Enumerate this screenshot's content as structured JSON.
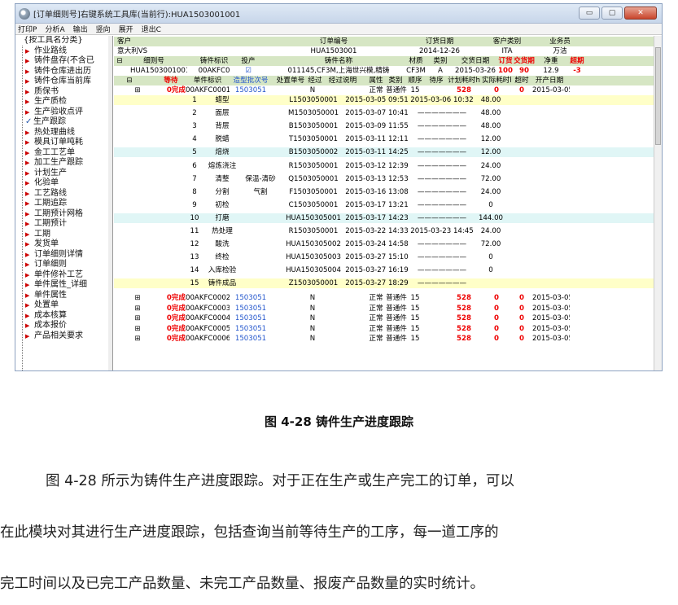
{
  "window": {
    "title": "[订单细则号]右键系统工具库(当前行):HUA1503001001",
    "buttons": {
      "minimize": "▭",
      "maximize": "▢",
      "close": "✕"
    }
  },
  "menu": [
    "打印P",
    "分析A",
    "输出",
    "竖向",
    "展开",
    "退出C"
  ],
  "tree": {
    "root": "{按工具名分类}",
    "items": [
      {
        "label": "作业路线",
        "mark": "▶"
      },
      {
        "label": "铸件盘存(不含已",
        "mark": "▶"
      },
      {
        "label": "铸件仓库进出历",
        "mark": "▶"
      },
      {
        "label": "铸件仓库当前库",
        "mark": "▶"
      },
      {
        "label": "质保书",
        "mark": "▶"
      },
      {
        "label": "生产质检",
        "mark": "▶"
      },
      {
        "label": "生产验收点评",
        "mark": "▶"
      },
      {
        "label": "生产跟踪",
        "mark": "✓"
      },
      {
        "label": "热处理曲线",
        "mark": "▶"
      },
      {
        "label": "模具订单吨耗",
        "mark": "▶"
      },
      {
        "label": "金工工艺单",
        "mark": "▶"
      },
      {
        "label": "加工生产跟踪",
        "mark": "▶"
      },
      {
        "label": "计划生产",
        "mark": "▶"
      },
      {
        "label": "化验单",
        "mark": "▶"
      },
      {
        "label": "工艺路线",
        "mark": "▶"
      },
      {
        "label": "工期追踪",
        "mark": "▶"
      },
      {
        "label": "工期预计网格",
        "mark": "▶"
      },
      {
        "label": "工期预计",
        "mark": "▶"
      },
      {
        "label": "工期",
        "mark": "▶"
      },
      {
        "label": "发货单",
        "mark": "▶"
      },
      {
        "label": "订单细则详情",
        "mark": "▶"
      },
      {
        "label": "订单细则",
        "mark": "▶"
      },
      {
        "label": "单件修补工艺",
        "mark": "▶"
      },
      {
        "label": "单件属性_详细",
        "mark": "▶"
      },
      {
        "label": "单件属性",
        "mark": "▶"
      },
      {
        "label": "处置单",
        "mark": "▶"
      },
      {
        "label": "成本核算",
        "mark": "▶"
      },
      {
        "label": "成本报价",
        "mark": "▶"
      },
      {
        "label": "产品相关要求",
        "mark": "▶"
      }
    ]
  },
  "order_header": {
    "cols": [
      "客户",
      "订单编号",
      "订货日期",
      "客户类别",
      "业务员"
    ],
    "vals": [
      "意大利VS",
      "HUA1503001",
      "2014-12-26",
      "ITA",
      "万洁"
    ]
  },
  "detail_header": {
    "cols": [
      "细则号",
      "铸件标识",
      "投产",
      "铸件名称",
      "材质",
      "类别",
      "交货日期",
      "订货",
      "交货期",
      "净重",
      "超期"
    ],
    "vals": [
      "HUA1503001001",
      "00AKFC0",
      "☑",
      "011145,CF3M,上海世兴模,精铸",
      "CF3M",
      "A",
      "2015-03-26",
      "100",
      "90",
      "12.9",
      "-3"
    ]
  },
  "piece_header": [
    "等待",
    "单件标识",
    "造型批次号",
    "处置单号",
    "经过",
    "经过说明",
    "属性",
    "类别",
    "顺序",
    "待序",
    "计划耗时h",
    "实际耗时h",
    "超时",
    "开产日期"
  ],
  "first_piece": {
    "status": "0完成",
    "id": "00AKFC0001",
    "batch": "1503051",
    "disp": "N",
    "attr": "正常",
    "kind": "普通件",
    "seq": "15",
    "plan": "528",
    "actual": "0",
    "over": "0",
    "date": "2015-03-05"
  },
  "processes": [
    {
      "n": "1",
      "name": "蜡型",
      "extra": "",
      "code": "L1503050001",
      "start": "2015-03-05 09:51",
      "end": "2015-03-06 10:32",
      "hours": "48.00"
    },
    {
      "n": "2",
      "name": "面层",
      "extra": "",
      "code": "M1503050001",
      "start": "2015-03-07 10:41",
      "end": "",
      "hours": "48.00"
    },
    {
      "n": "3",
      "name": "背层",
      "extra": "",
      "code": "B1503050001",
      "start": "2015-03-09 11:55",
      "end": "",
      "hours": "48.00"
    },
    {
      "n": "4",
      "name": "脱蜡",
      "extra": "",
      "code": "T1503050001",
      "start": "2015-03-11 12:11",
      "end": "",
      "hours": "12.00"
    },
    {
      "n": "5",
      "name": "焙烧",
      "extra": "",
      "code": "B1503050002",
      "start": "2015-03-11 14:25",
      "end": "",
      "hours": "12.00"
    },
    {
      "n": "6",
      "name": "熔炼浇注",
      "extra": "",
      "code": "R1503050001",
      "start": "2015-03-12 12:39",
      "end": "",
      "hours": "24.00"
    },
    {
      "n": "7",
      "name": "清整",
      "extra": "保温-清砂",
      "code": "Q1503050001",
      "start": "2015-03-13 12:53",
      "end": "",
      "hours": "72.00"
    },
    {
      "n": "8",
      "name": "分割",
      "extra": "气割",
      "code": "F1503050001",
      "start": "2015-03-16 13:08",
      "end": "",
      "hours": "24.00"
    },
    {
      "n": "9",
      "name": "初检",
      "extra": "",
      "code": "C1503050001",
      "start": "2015-03-17 13:21",
      "end": "",
      "hours": "0"
    },
    {
      "n": "10",
      "name": "打磨",
      "extra": "",
      "code": "HUA150305001",
      "start": "2015-03-17 14:23",
      "end": "",
      "hours": "144.00"
    },
    {
      "n": "11",
      "name": "热处理",
      "extra": "",
      "code": "R1503050001",
      "start": "2015-03-22 14:33",
      "end": "2015-03-23 14:45",
      "hours": "24.00"
    },
    {
      "n": "12",
      "name": "酸洗",
      "extra": "",
      "code": "HUA150305002",
      "start": "2015-03-24 14:58",
      "end": "",
      "hours": "72.00"
    },
    {
      "n": "13",
      "name": "终检",
      "extra": "",
      "code": "HUA150305003",
      "start": "2015-03-27 15:10",
      "end": "",
      "hours": "0"
    },
    {
      "n": "14",
      "name": "入库检验",
      "extra": "",
      "code": "HUA150305004",
      "start": "2015-03-27 16:19",
      "end": "",
      "hours": "0"
    },
    {
      "n": "15",
      "name": "铸件成品",
      "extra": "",
      "code": "Z1503050001",
      "start": "2015-03-27 18:29",
      "end": "",
      "hours": ""
    }
  ],
  "other_pieces": [
    {
      "status": "0完成",
      "id": "00AKFC0002",
      "batch": "1503051",
      "disp": "N",
      "attr": "正常",
      "kind": "普通件",
      "seq": "15",
      "plan": "528",
      "actual": "0",
      "over": "0",
      "date": "2015-03-05"
    },
    {
      "status": "0完成",
      "id": "00AKFC0003",
      "batch": "1503051",
      "disp": "N",
      "attr": "正常",
      "kind": "普通件",
      "seq": "15",
      "plan": "528",
      "actual": "0",
      "over": "0",
      "date": "2015-03-05"
    },
    {
      "status": "0完成",
      "id": "00AKFC0004",
      "batch": "1503051",
      "disp": "N",
      "attr": "正常",
      "kind": "普通件",
      "seq": "15",
      "plan": "528",
      "actual": "0",
      "over": "0",
      "date": "2015-03-05"
    },
    {
      "status": "0完成",
      "id": "00AKFC0005",
      "batch": "1503051",
      "disp": "N",
      "attr": "正常",
      "kind": "普通件",
      "seq": "15",
      "plan": "528",
      "actual": "0",
      "over": "0",
      "date": "2015-03-05"
    },
    {
      "status": "0完成",
      "id": "00AKFC0006",
      "batch": "1503051",
      "disp": "N",
      "attr": "正常",
      "kind": "普通件",
      "seq": "15",
      "plan": "528",
      "actual": "0",
      "over": "0",
      "date": "2015-03-05"
    }
  ],
  "caption": "图 4-28  铸件生产进度跟踪",
  "paragraph": [
    "图 4-28 所示为铸件生产进度跟踪。对于正在生产或生产完工的订单，可以",
    "在此模块对其进行生产进度跟踪，包括查询当前等待生产的工序，每一道工序的",
    "完工时间以及已完工产品数量、未完工产品数量、报废产品数量的实时统计。"
  ]
}
